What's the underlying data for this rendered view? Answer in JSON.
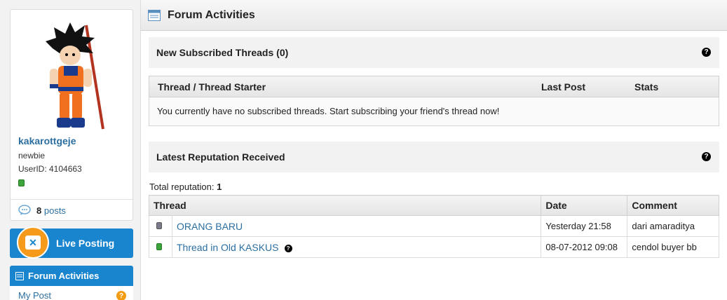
{
  "profile": {
    "username": "kakarottgeje",
    "rank": "newbie",
    "user_id": "UserID: 4104663",
    "post_count": "8",
    "posts_label": "posts"
  },
  "sidebar": {
    "live_posting": "Live Posting",
    "forum_activities": "Forum Activities",
    "my_post": "My Post"
  },
  "header": {
    "title": "Forum Activities"
  },
  "subscribed": {
    "title": "New Subscribed Threads (0)",
    "columns": [
      "Thread / Thread Starter",
      "Last Post",
      "Stats"
    ],
    "empty_message": "You currently have no subscribed threads. Start subscribing your friend's thread now!"
  },
  "reputation": {
    "title": "Latest Reputation Received",
    "total_label": "Total reputation:",
    "total_value": "1",
    "columns": [
      "Thread",
      "Date",
      "Comment"
    ],
    "rows": [
      {
        "thread": "ORANG BARU",
        "date": "Yesterday 21:58",
        "comment": "dari amaraditya",
        "status": "grey"
      },
      {
        "thread": "Thread in Old KASKUS",
        "date": "08-07-2012 09:08",
        "comment": "cendol buyer bb",
        "status": "green"
      }
    ]
  },
  "colors": {
    "accent": "#1a85cf",
    "link": "#2b6ea0",
    "badge": "#f59a1b"
  }
}
